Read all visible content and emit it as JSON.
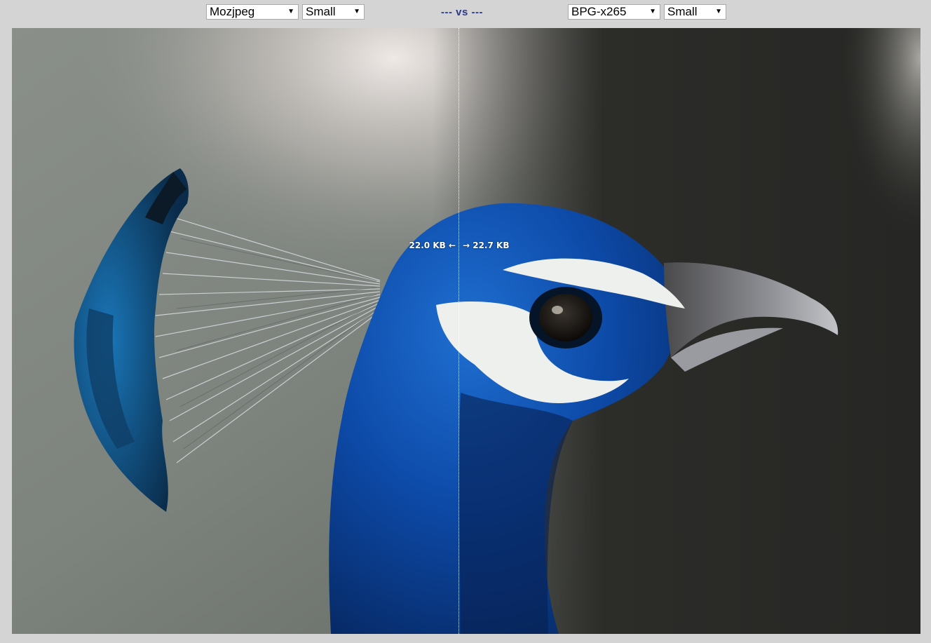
{
  "toolbar": {
    "left_codec": "Mozjpeg",
    "left_size": "Small",
    "vs_label": "--- vs ---",
    "right_codec": "BPG-x265",
    "right_size": "Small"
  },
  "comparison": {
    "left_filesize": "22.0 KB ←",
    "right_filesize": "→ 22.7 KB",
    "split_position_percent": 49.2
  },
  "image": {
    "subject": "peacock-head-photo"
  },
  "colors": {
    "page_background": "#d4d4d4",
    "vs_text": "#2b3a8c",
    "divider": "#ffffff"
  }
}
